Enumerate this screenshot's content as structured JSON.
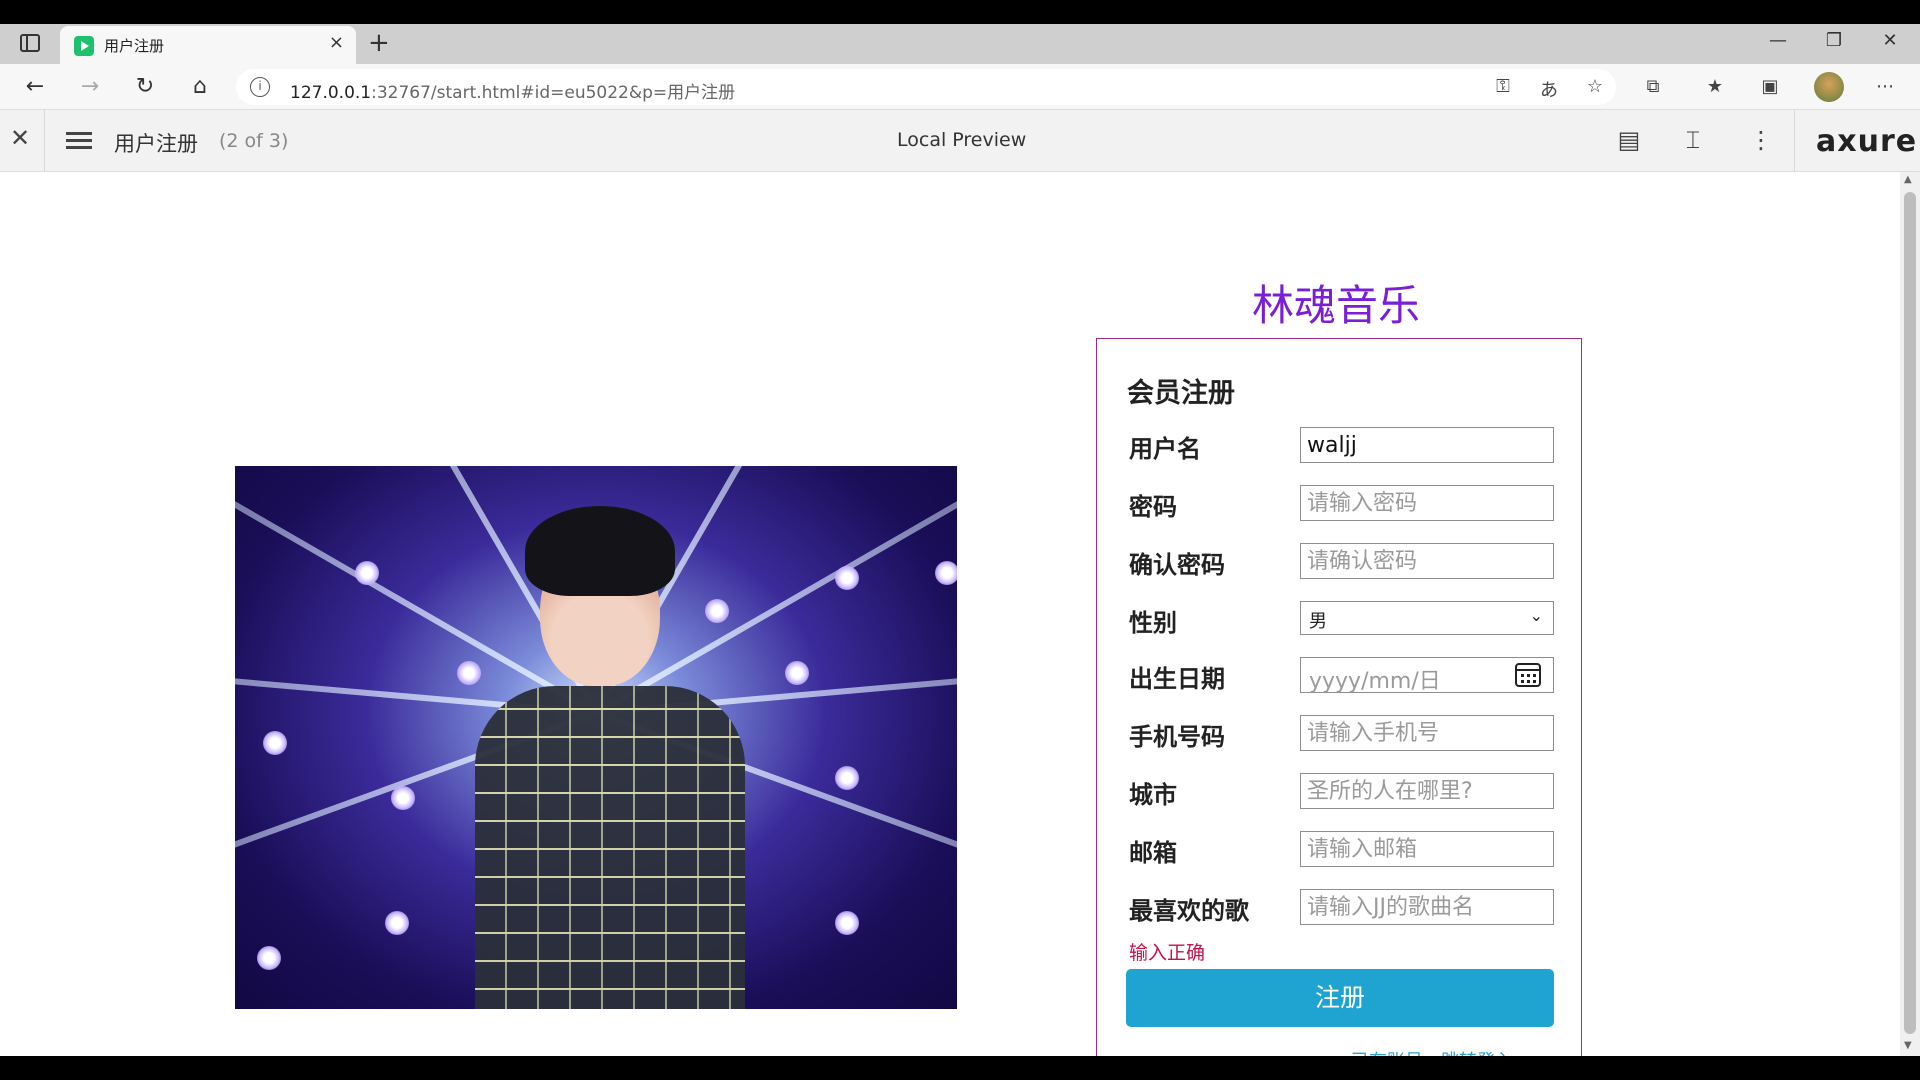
{
  "browser": {
    "tab_title": "用户注册",
    "tab_close": "×",
    "new_tab": "+",
    "url_host": "127.0.0.1",
    "url_rest": ":32767/start.html#id=eu5022&p=用户注册",
    "window_minimize": "—",
    "window_restore": "❐",
    "window_close": "✕"
  },
  "axure": {
    "page_name": "用户注册",
    "page_count": "(2 of 3)",
    "center_label": "Local Preview",
    "logo": "axure"
  },
  "page": {
    "site_title": "林魂音乐",
    "form": {
      "heading": "会员注册",
      "username": {
        "label": "用户名",
        "value": "waljj"
      },
      "password": {
        "label": "密码",
        "placeholder": "请输入密码"
      },
      "confirm": {
        "label": "确认密码",
        "placeholder": "请确认密码"
      },
      "gender": {
        "label": "性别",
        "value": "男"
      },
      "birthday": {
        "label": "出生日期",
        "placeholder": "yyyy/mm/日"
      },
      "phone": {
        "label": "手机号码",
        "placeholder": "请输入手机号"
      },
      "city": {
        "label": "城市",
        "placeholder": "圣所的人在哪里?"
      },
      "email": {
        "label": "邮箱",
        "placeholder": "请输入邮箱"
      },
      "song": {
        "label": "最喜欢的歌",
        "placeholder": "请输入JJ的歌曲名"
      },
      "hint": "输入正确",
      "submit": "注册",
      "login_link": "已有账号，跳转登入>>"
    }
  },
  "colors": {
    "title": "#7a1fd6",
    "form_border": "#9b2a8f",
    "submit_bg": "#1fa3d0",
    "hint": "#c0134a",
    "link": "#2a9fd6"
  }
}
